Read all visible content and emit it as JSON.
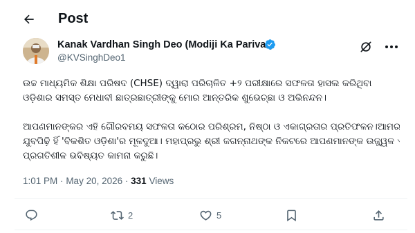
{
  "header": {
    "back_icon": "arrow-left-icon",
    "title": "Post"
  },
  "author": {
    "name": "Kanak Vardhan Singh Deo (Modiji Ka Parivar)",
    "handle": "@KVSinghDeo1",
    "verified_color": "#1d9bf0",
    "grok_icon": "grok-icon",
    "more_icon": "more-horizontal-icon"
  },
  "tweet": {
    "line1": "ଉଚ୍ଚ ମାଧ୍ୟମିକ ଶିକ୍ଷା ପରିଷଦ (CHSE) ଦ୍ୱାରା ପରିଚାଳିତ +୨ ପରୀକ୍ଷାରେ ସଫଳତା ହାସଲ କରିଥିବା",
    "line2": "ଓଡ଼ିଶାର ସମସ୍ତ ମେଧାବୀ ଛାତ୍ରଛାତ୍ରୀଙ୍କୁ ମୋର ଆନ୍ତରିକ ଶୁଭେଚ୍ଛା ଓ ଅଭିନନ୍ଦନ।",
    "line3": "ଆପଣମାନଙ୍କର ଏହି ଗୌରବମୟ ସଫଳତା କଠୋର ପରିଶ୍ରମ, ନିଷ୍ଠା ଓ ଏକାଗ୍ରତାର ପ୍ରତିଫଳନ।ଆମର",
    "line4": "ଯୁବପିଢ଼ି ହିଁ 'ବିକଶିତ ଓଡ଼ିଶା'ର ମୂଳଦୁଆ। ମହାପ୍ରଭୁ ଶ୍ରୀ ଜଗନ୍ନାଥଙ୍କ ନିକଟରେ ଆପଣମାନଙ୍କ ଉଜ୍ଜ୍ୱଳ ଏବଂ",
    "line5": "ପ୍ରଗତିଶୀଳ ଭବିଷ୍ୟତ କାମନା କରୁଛି।"
  },
  "meta": {
    "time": "1:01 PM",
    "separator": "·",
    "date": "May 20, 2026",
    "views_count": "331",
    "views_label": "Views"
  },
  "actions": {
    "reply_icon": "reply-icon",
    "repost_icon": "repost-icon",
    "repost_count": "2",
    "like_icon": "heart-icon",
    "like_count": "5",
    "bookmark_icon": "bookmark-icon",
    "share_icon": "share-icon",
    "icon_color": "#536471"
  }
}
